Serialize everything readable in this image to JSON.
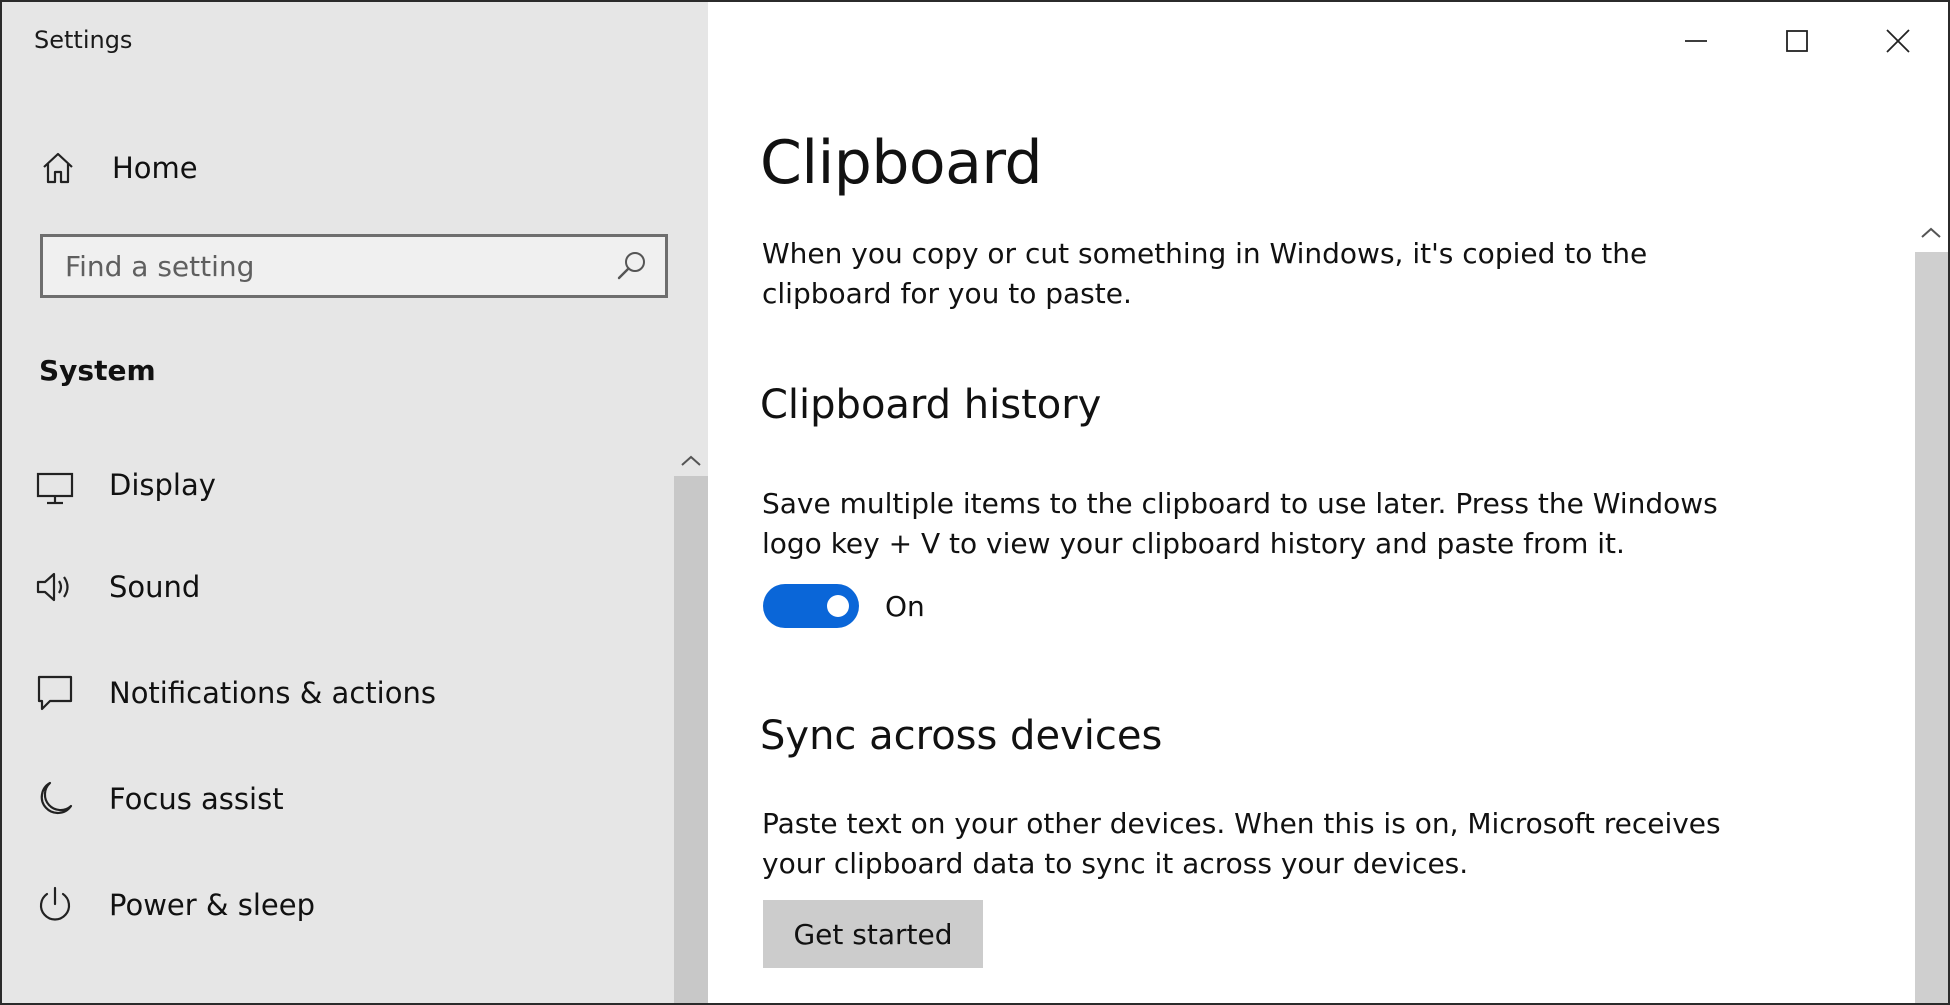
{
  "window": {
    "title": "Settings"
  },
  "nav": {
    "home_label": "Home",
    "search_placeholder": "Find a setting",
    "section_heading": "System",
    "items": [
      {
        "label": "Display",
        "icon": "display-icon"
      },
      {
        "label": "Sound",
        "icon": "speaker-icon"
      },
      {
        "label": "Notifications & actions",
        "icon": "message-icon"
      },
      {
        "label": "Focus assist",
        "icon": "moon-icon"
      },
      {
        "label": "Power & sleep",
        "icon": "power-icon"
      }
    ]
  },
  "controls": {
    "minimize": "minimize-icon",
    "maximize": "maximize-icon",
    "close": "close-icon"
  },
  "page": {
    "title": "Clipboard",
    "intro": "When you copy or cut something in Windows, it's copied to the clipboard for you to paste.",
    "history": {
      "heading": "Clipboard history",
      "description": "Save multiple items to the clipboard to use later. Press the Windows logo key + V to view your clipboard history and paste from it.",
      "toggle_on": true,
      "toggle_label": "On"
    },
    "sync": {
      "heading": "Sync across devices",
      "description": "Paste text on your other devices. When this is on, Microsoft receives your clipboard data to sync it across your devices.",
      "button_label": "Get started"
    }
  },
  "colors": {
    "nav_background": "#e6e6e6",
    "accent": "#0a66d8",
    "button_background": "#cccccc"
  }
}
